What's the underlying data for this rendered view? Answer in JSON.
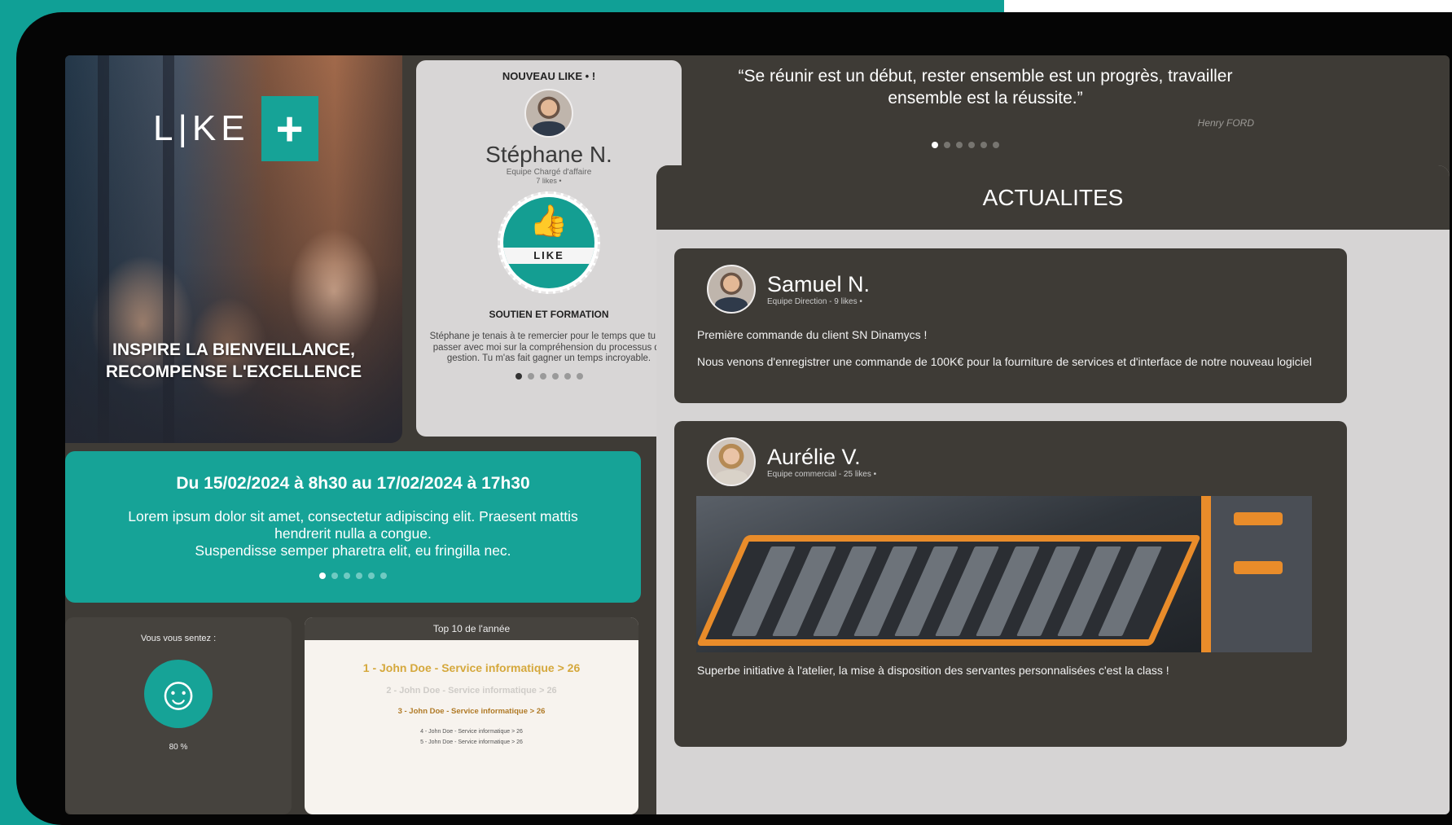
{
  "hero": {
    "logo_text": "L|KE",
    "logo_plus": "+",
    "tagline_1": "INSPIRE LA BIENVEILLANCE,",
    "tagline_2": "RECOMPENSE L'EXCELLENCE"
  },
  "new_like": {
    "title": "NOUVEAU LIKE • !",
    "name": "Stéphane N.",
    "team": "Equipe Chargé d'affaire",
    "likes": "7 likes •",
    "badge_label": "LIKE",
    "category": "SOUTIEN ET FORMATION",
    "message": "Stéphane je tenais à te remercier pour le temps que tu as passer avec moi sur la compréhension du processus de gestion. Tu m'as fait gagner un temps incroyable."
  },
  "quote": {
    "text": "“Se réunir est un début, rester ensemble est un progrès, travailler ensemble est la réussite.”",
    "author": "Henry FORD"
  },
  "event": {
    "title": "Du 15/02/2024 à 8h30 au 17/02/2024 à 17h30",
    "line_1": "Lorem ipsum dolor sit amet, consectetur adipiscing elit. Praesent mattis hendrerit nulla a congue.",
    "line_2": "Suspendisse semper pharetra elit, eu fringilla nec."
  },
  "mood": {
    "title": "Vous vous sentez :",
    "percent": "80 %"
  },
  "top10": {
    "title": "Top 10 de l'année",
    "entries": [
      "1 - John Doe - Service informatique > 26",
      "2 - John Doe - Service informatique > 26",
      "3 - John Doe - Service informatique > 26",
      "4 - John Doe - Service informatique > 26",
      "5 - John Doe - Service informatique > 26"
    ]
  },
  "news": {
    "title": "ACTUALITES",
    "posts": [
      {
        "name": "Samuel N.",
        "team": "Equipe Direction - 9 likes •",
        "text_1": "Première commande du client SN Dinamycs !",
        "text_2": "Nous venons d'enregistrer une commande de 100K€ pour la fourniture de services et d'interface de notre nouveau logiciel"
      },
      {
        "name": "Aurélie V.",
        "team": "Equipe commercial - 25 likes •",
        "text_1": "Superbe initiative à l'atelier, la mise à disposition des servantes personnalisées c'est la class !"
      }
    ]
  },
  "carousel": {
    "new_like_active": 1,
    "quote_active": 1,
    "event_active": 1,
    "total": 6
  },
  "colors": {
    "accent": "#16a397",
    "panel_dark": "#3e3b36",
    "card_light": "#d8d6d6",
    "gold": "#d5a83c"
  }
}
